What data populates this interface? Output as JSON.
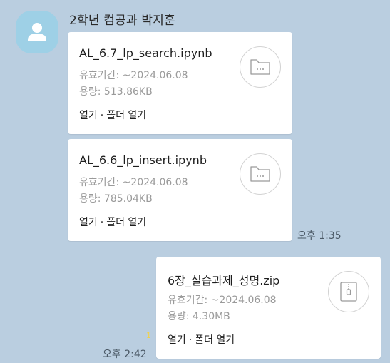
{
  "sender": {
    "name": "2학년 컴공과 박지훈"
  },
  "messages": [
    {
      "file_name": "AL_6.7_lp_search.ipynb",
      "expiry": "유효기간: ~2024.06.08",
      "size": "용량: 513.86KB",
      "open_label": "열기",
      "separator": "·",
      "open_folder_label": "폴더 열기",
      "icon": "folder-icon"
    },
    {
      "file_name": "AL_6.6_lp_insert.ipynb",
      "expiry": "유효기간: ~2024.06.08",
      "size": "용량: 785.04KB",
      "open_label": "열기",
      "separator": "·",
      "open_folder_label": "폴더 열기",
      "icon": "folder-icon"
    },
    {
      "file_name": "6장_실습과제_성명.zip",
      "expiry": "유효기간: ~2024.06.08",
      "size": "용량: 4.30MB",
      "open_label": "열기",
      "separator": "·",
      "open_folder_label": "폴더 열기",
      "icon": "zip-file-icon"
    }
  ],
  "timestamps": {
    "incoming": "오후 1:35",
    "outgoing": "오후 2:42"
  },
  "unread_count": "1",
  "colors": {
    "background": "#bacee0",
    "bubble": "#ffffff",
    "avatar": "#9ed0e6",
    "unread": "#f2d24a"
  }
}
